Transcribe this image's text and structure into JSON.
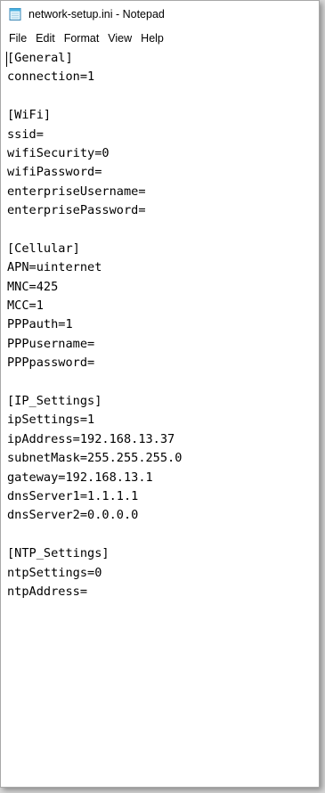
{
  "window": {
    "title": "network-setup.ini - Notepad"
  },
  "icons": {
    "app": "notepad-icon"
  },
  "menu": [
    "File",
    "Edit",
    "Format",
    "View",
    "Help"
  ],
  "editor": {
    "lines": [
      "[General]",
      "connection=1",
      "",
      "[WiFi]",
      "ssid=",
      "wifiSecurity=0",
      "wifiPassword=",
      "enterpriseUsername=",
      "enterprisePassword=",
      "",
      "[Cellular]",
      "APN=uinternet",
      "MNC=425",
      "MCC=1",
      "PPPauth=1",
      "PPPusername=",
      "PPPpassword=",
      "",
      "[IP_Settings]",
      "ipSettings=1",
      "ipAddress=192.168.13.37",
      "subnetMask=255.255.255.0",
      "gateway=192.168.13.1",
      "dnsServer1=1.1.1.1",
      "dnsServer2=0.0.0.0",
      "",
      "[NTP_Settings]",
      "ntpSettings=0",
      "ntpAddress="
    ]
  }
}
